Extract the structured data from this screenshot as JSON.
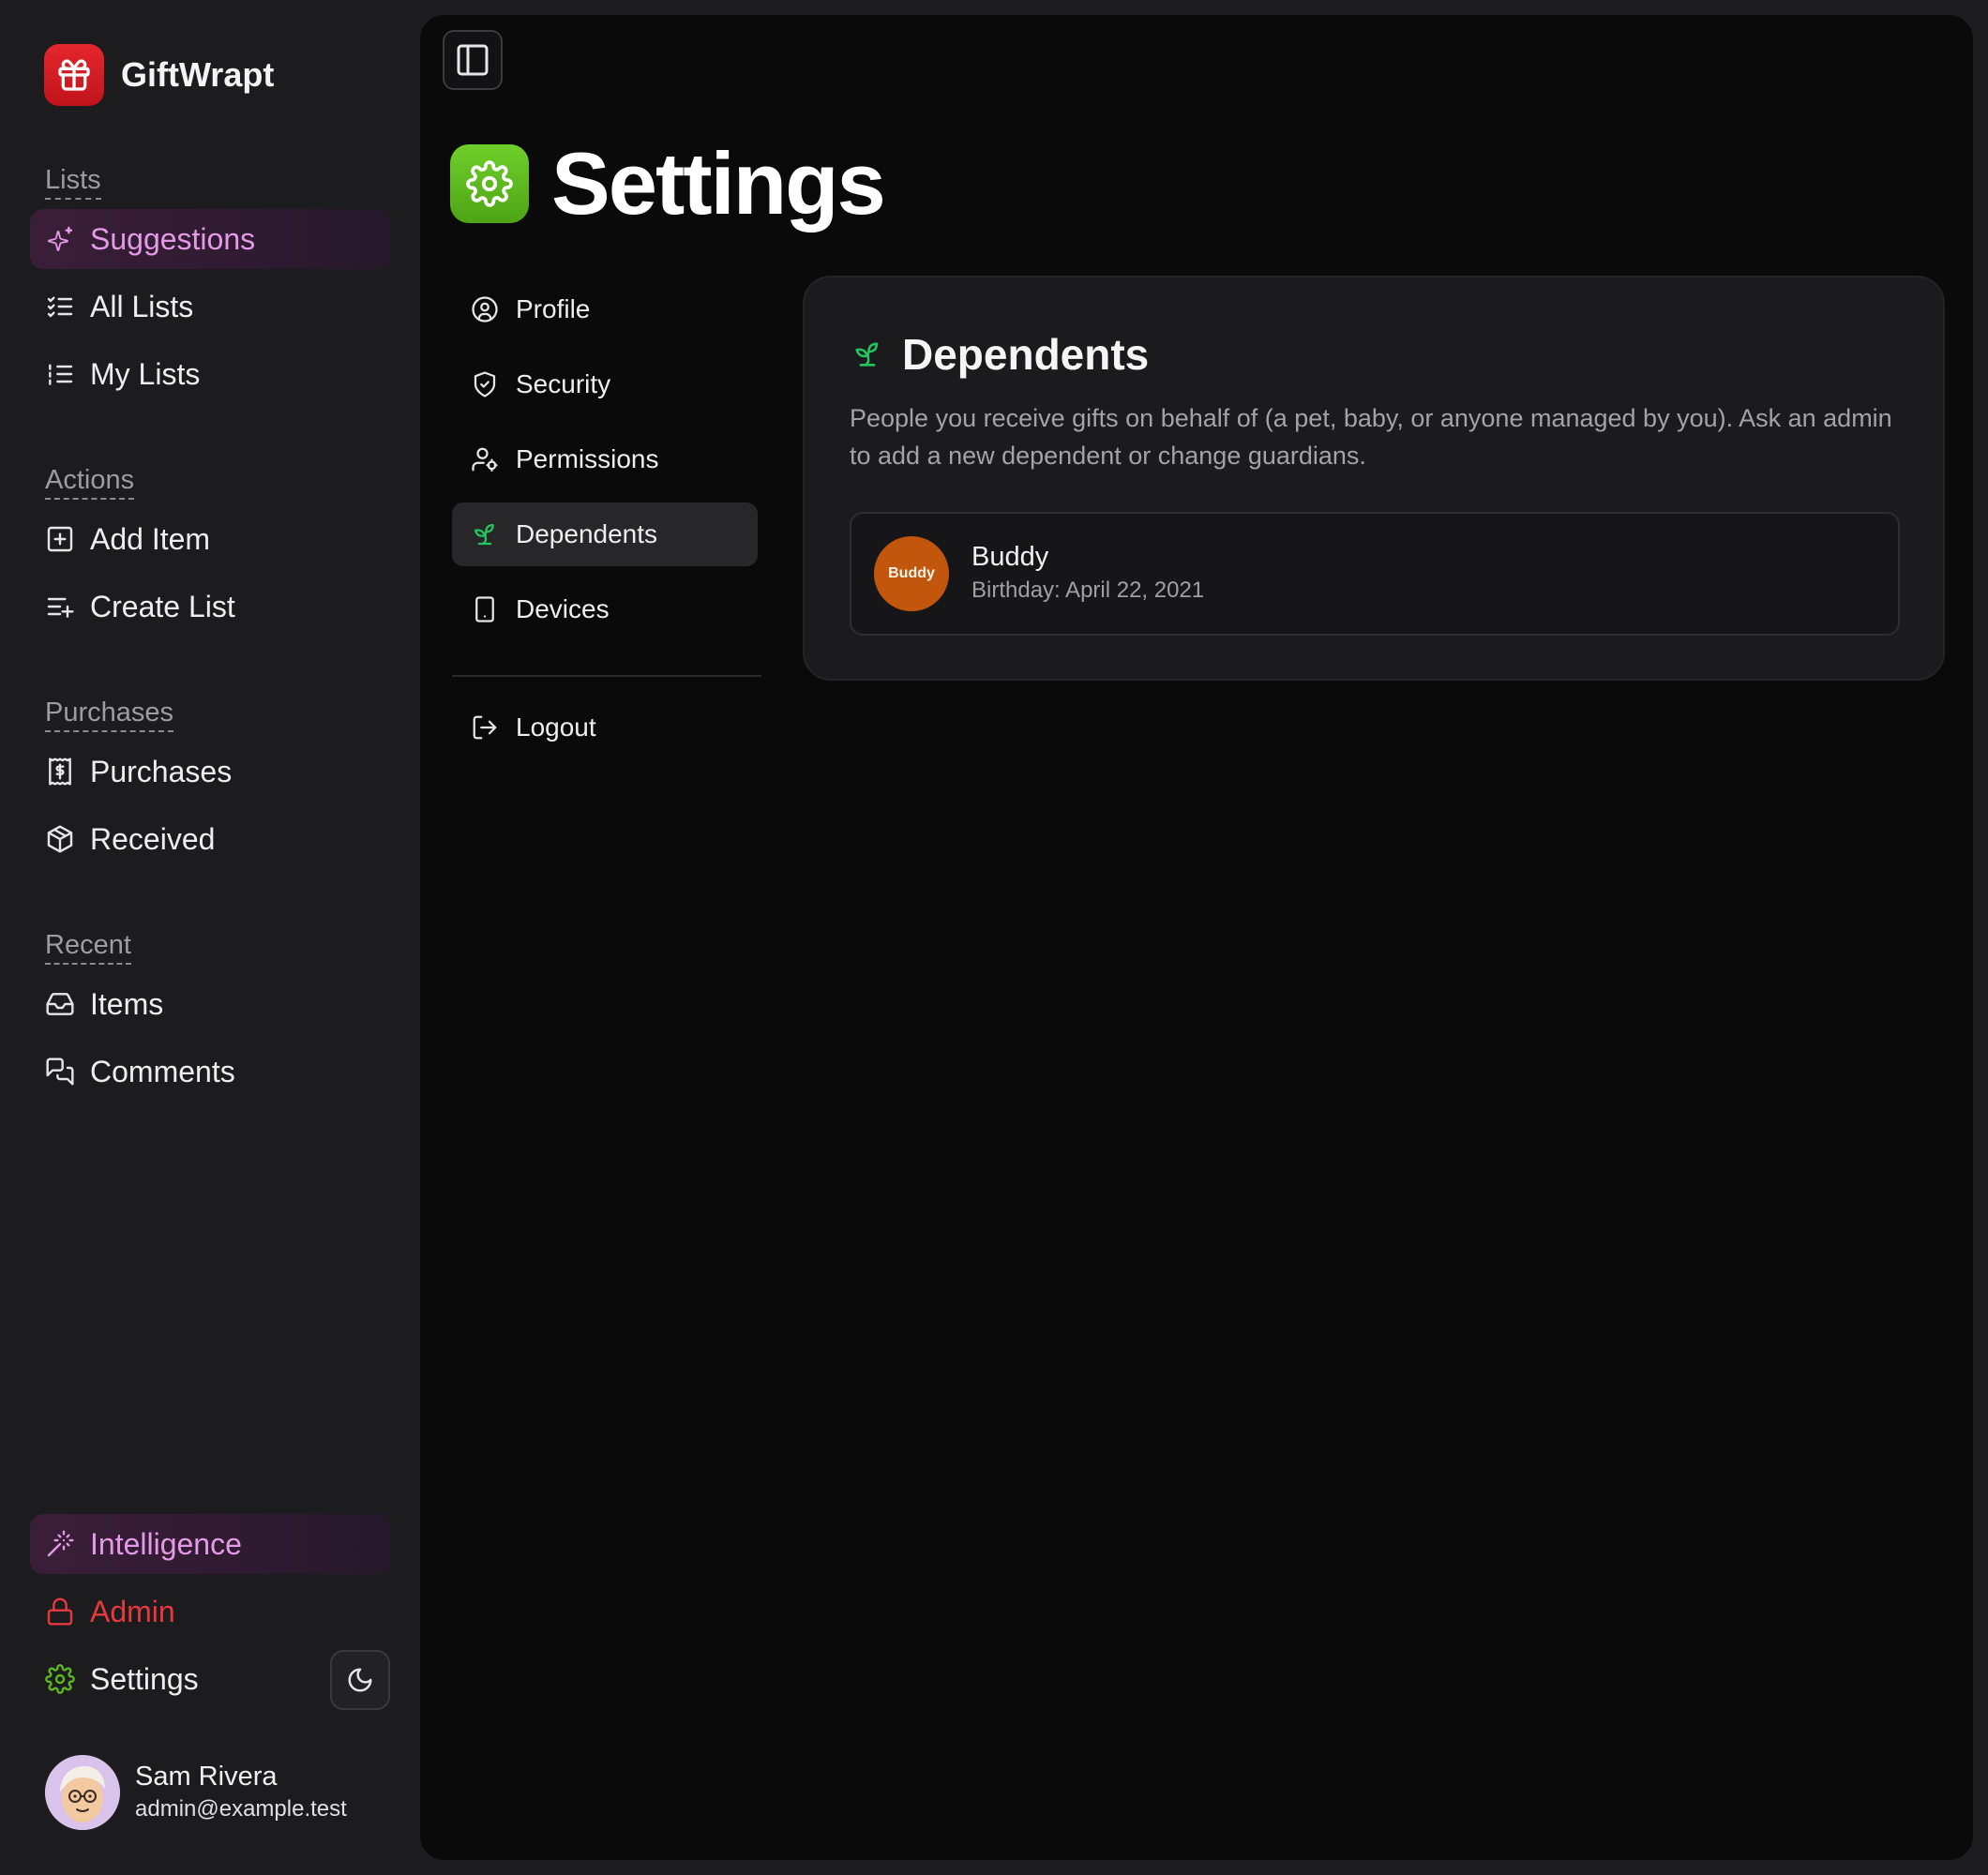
{
  "app": {
    "name": "GiftWrapt",
    "accent": "#e5262d"
  },
  "sidebar": {
    "sections": {
      "lists": "Lists",
      "actions": "Actions",
      "purchases": "Purchases",
      "recent": "Recent"
    },
    "items": {
      "suggestions": "Suggestions",
      "all_lists": "All Lists",
      "my_lists": "My Lists",
      "add_item": "Add Item",
      "create_list": "Create List",
      "purchases": "Purchases",
      "received": "Received",
      "items": "Items",
      "comments": "Comments",
      "intelligence": "Intelligence",
      "admin": "Admin",
      "settings": "Settings"
    },
    "active_color": "#e59ae8",
    "admin_color": "#e6393d"
  },
  "user": {
    "name": "Sam Rivera",
    "email": "admin@example.test"
  },
  "page": {
    "title": "Settings",
    "icon": "gear-icon",
    "icon_color": "#5cb81d"
  },
  "settings_nav": {
    "profile": "Profile",
    "security": "Security",
    "permissions": "Permissions",
    "dependents": "Dependents",
    "devices": "Devices",
    "logout": "Logout",
    "active": "Dependents"
  },
  "dependents": {
    "title": "Dependents",
    "description": "People you receive gifts on behalf of (a pet, baby, or anyone managed by you). Ask an admin to add a new dependent or change guardians.",
    "list": [
      {
        "avatar_text": "Buddy",
        "name": "Buddy",
        "birthday": "Birthday: April 22, 2021",
        "avatar_color": "#c2560c"
      }
    ]
  }
}
